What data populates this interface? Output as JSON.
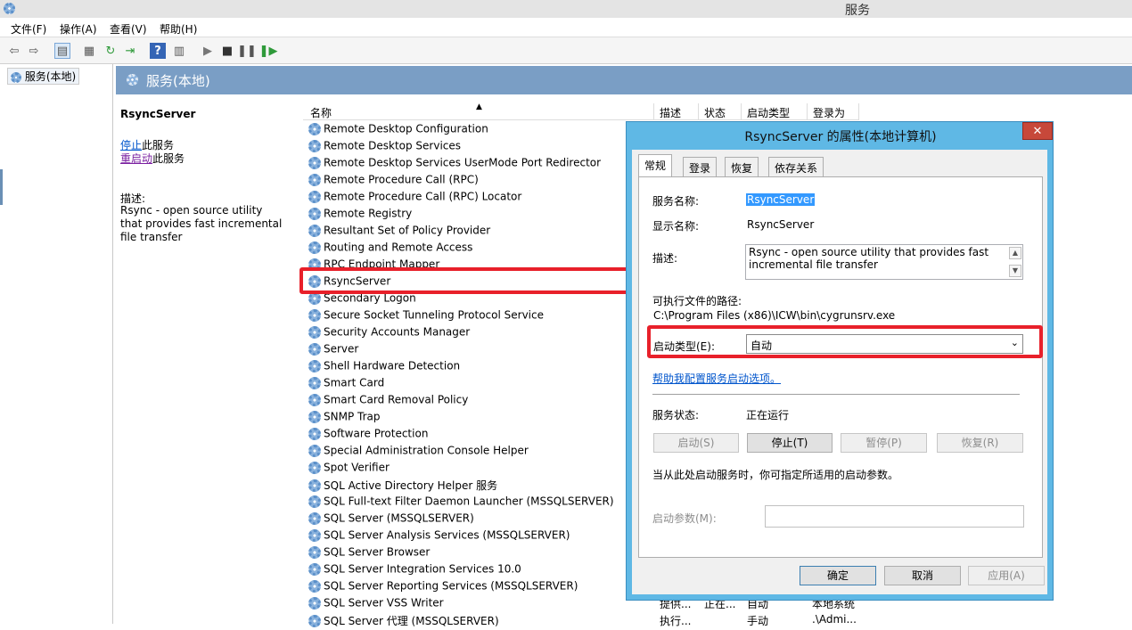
{
  "window": {
    "title": "服务"
  },
  "menu": [
    "文件(F)",
    "操作(A)",
    "查看(V)",
    "帮助(H)"
  ],
  "tree": {
    "node": "服务(本地)"
  },
  "panel": {
    "title": "服务(本地)",
    "selected_name": "RsyncServer",
    "stop_link": "停止",
    "stop_suffix": "此服务",
    "restart_link": "重启动",
    "restart_suffix": "此服务",
    "desc_label": "描述:",
    "desc_text": "Rsync - open source utility that provides fast incremental file transfer"
  },
  "list": {
    "columns": [
      "名称",
      "描述",
      "状态",
      "启动类型",
      "登录为"
    ],
    "rows": [
      "Remote Desktop Configuration",
      "Remote Desktop Services",
      "Remote Desktop Services UserMode Port Redirector",
      "Remote Procedure Call (RPC)",
      "Remote Procedure Call (RPC) Locator",
      "Remote Registry",
      "Resultant Set of Policy Provider",
      "Routing and Remote Access",
      "RPC Endpoint Mapper",
      "RsyncServer",
      "Secondary Logon",
      "Secure Socket Tunneling Protocol Service",
      "Security Accounts Manager",
      "Server",
      "Shell Hardware Detection",
      "Smart Card",
      "Smart Card Removal Policy",
      "SNMP Trap",
      "Software Protection",
      "Special Administration Console Helper",
      "Spot Verifier",
      "SQL Active Directory Helper 服务",
      "SQL Full-text Filter Daemon Launcher (MSSQLSERVER)",
      "SQL Server (MSSQLSERVER)",
      "SQL Server Analysis Services (MSSQLSERVER)",
      "SQL Server Browser",
      "SQL Server Integration Services 10.0",
      "SQL Server Reporting Services (MSSQLSERVER)",
      "SQL Server VSS Writer",
      "SQL Server 代理 (MSSQLSERVER)"
    ],
    "bottom_row_1": {
      "desc": "提供...",
      "status": "正在...",
      "startup": "自动",
      "logon": "本地系统"
    },
    "bottom_row_2": {
      "desc": "执行...",
      "startup": "手动",
      "logon": ".\\Admi..."
    }
  },
  "dialog": {
    "title": "RsyncServer 的属性(本地计算机)",
    "close": "✕",
    "tabs": [
      "常规",
      "登录",
      "恢复",
      "依存关系"
    ],
    "service_name_label": "服务名称:",
    "service_name": "RsyncServer",
    "display_name_label": "显示名称:",
    "display_name": "RsyncServer",
    "desc_label": "描述:",
    "desc_text": "Rsync - open source utility that provides fast incremental file transfer",
    "path_label": "可执行文件的路径:",
    "path": "C:\\Program Files (x86)\\ICW\\bin\\cygrunsrv.exe",
    "startup_label": "启动类型(E):",
    "startup_value": "自动",
    "help_link": "帮助我配置服务启动选项。",
    "status_label": "服务状态:",
    "status_value": "正在运行",
    "btn_start": "启动(S)",
    "btn_stop": "停止(T)",
    "btn_pause": "暂停(P)",
    "btn_resume": "恢复(R)",
    "hint": "当从此处启动服务时，你可指定所适用的启动参数。",
    "params_label": "启动参数(M):",
    "ok": "确定",
    "cancel": "取消",
    "apply": "应用(A)"
  },
  "colors": {
    "highlight": "#e8202a",
    "dialog_frame": "#5fb8e5",
    "panel_header": "#7a9ec5"
  }
}
